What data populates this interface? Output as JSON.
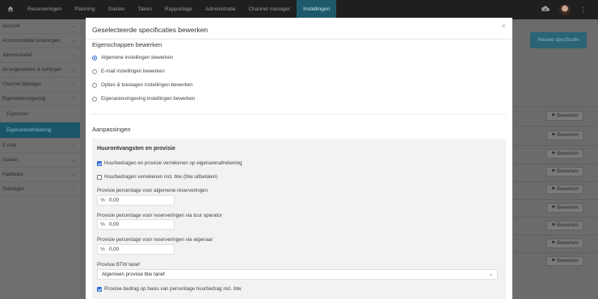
{
  "topnav": {
    "home_icon": "home-icon",
    "items": [
      {
        "label": "Reserveringen"
      },
      {
        "label": "Planning"
      },
      {
        "label": "Gasten"
      },
      {
        "label": "Taken"
      },
      {
        "label": "Rapportage"
      },
      {
        "label": "Administratie"
      },
      {
        "label": "Channel manager"
      },
      {
        "label": "Instellingen",
        "active": true
      }
    ]
  },
  "sidebar": {
    "items": [
      {
        "label": "Account",
        "chevron": "⌄"
      },
      {
        "label": "Accommodatie instellingen",
        "chevron": "⌄"
      },
      {
        "label": "Administratief",
        "chevron": "⌄"
      },
      {
        "label": "Arrangementen & kortingen",
        "chevron": "⌄"
      },
      {
        "label": "Channel Manager",
        "chevron": "⌄"
      },
      {
        "label": "Eigenarenomgeving",
        "chevron": "⌃"
      },
      {
        "label": "Eigenaren",
        "sub": true
      },
      {
        "label": "Eigenarenafrekening",
        "sub": true,
        "active": true
      },
      {
        "label": "E-mail",
        "chevron": "⌄"
      },
      {
        "label": "Gasten",
        "chevron": "⌄"
      },
      {
        "label": "Hardware",
        "chevron": "⌄"
      },
      {
        "label": "Toeslagen",
        "chevron": "⌄"
      }
    ]
  },
  "background": {
    "new_button": "Nieuwe specificatie",
    "edit_label": "Bewerken"
  },
  "modal": {
    "title": "Geselecteerde specificaties bewerken",
    "close": "×",
    "properties_title": "Eigenschappen bewerken",
    "radios": [
      {
        "label": "Algemene instellingen bewerken",
        "checked": true
      },
      {
        "label": "E-mail instellingen bewerken",
        "checked": false
      },
      {
        "label": "Opties & toeslagen instellingen bewerken",
        "checked": false
      },
      {
        "label": "Eigenarenomgeving instellingen bewerken",
        "checked": false
      }
    ],
    "adjustments_title": "Aanpassingen",
    "panel": {
      "title": "Huurontvangsten en provisie",
      "check1": {
        "label": "Huurbedragen en provisie verrekenen op eigenarenafrekening",
        "checked": true
      },
      "check2": {
        "label": "Huurbedragen verrekenen incl. btw (btw uitbetalen)",
        "checked": false
      },
      "field1": {
        "label": "Provisie percentage voor algemene reserveringen",
        "symbol": "%",
        "value": "0,00"
      },
      "field2": {
        "label": "Provisie percentage voor reserveringen via tour operator",
        "symbol": "%",
        "value": "0,00"
      },
      "field3": {
        "label": "Provisie percentage voor reserveringen via eigenaar",
        "symbol": "%",
        "value": "0,00"
      },
      "btw": {
        "label": "Provisie BTW tarief",
        "selected": "Algemeen provisie btw tarief"
      },
      "check3": {
        "label": "Provisie bedrag op basis van percentage huurbedrag incl. btw",
        "checked": true
      }
    }
  }
}
